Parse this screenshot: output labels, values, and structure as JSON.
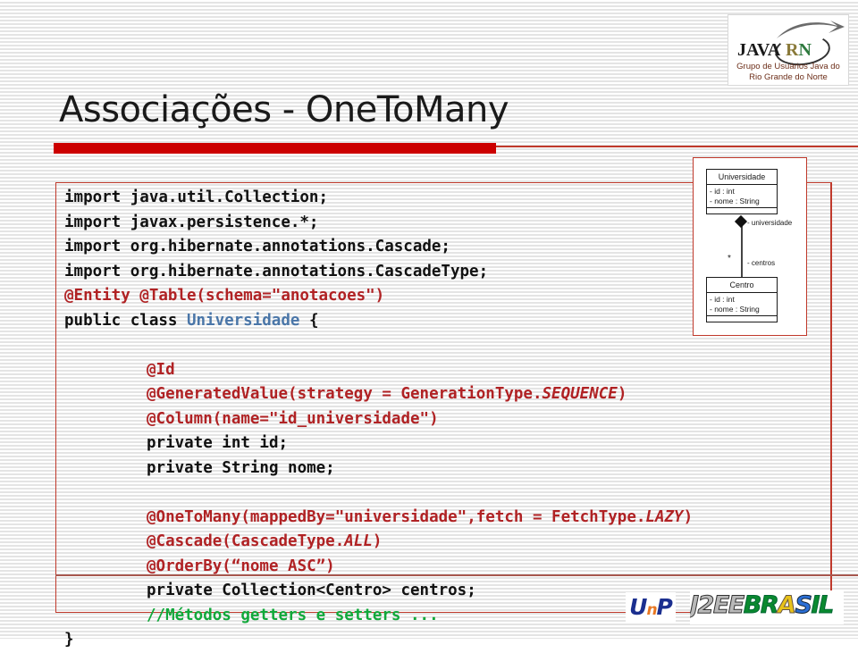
{
  "slide": {
    "title": "Associações - OneToMany"
  },
  "logo_top": {
    "name": "javarn-logo",
    "java_word": "JAVA",
    "rn_r": "R",
    "rn_n": "N",
    "tagline_line1": "Grupo de Usuários Java do",
    "tagline_line2": "Rio Grande do Norte"
  },
  "code": {
    "lines": [
      {
        "indent": false,
        "parts": [
          {
            "text": "import java.util.Collection;",
            "style": "plain"
          }
        ]
      },
      {
        "indent": false,
        "parts": [
          {
            "text": "import javax.persistence.*;",
            "style": "plain"
          }
        ]
      },
      {
        "indent": false,
        "parts": [
          {
            "text": "import org.hibernate.annotations.Cascade;",
            "style": "plain"
          }
        ]
      },
      {
        "indent": false,
        "parts": [
          {
            "text": "import org.hibernate.annotations.CascadeType;",
            "style": "plain"
          }
        ]
      },
      {
        "indent": false,
        "parts": [
          {
            "text": "@Entity @Table(schema=\"anotacoes\")",
            "style": "ann"
          }
        ]
      },
      {
        "indent": false,
        "parts": [
          {
            "text": "public class ",
            "style": "plain"
          },
          {
            "text": "Universidade",
            "style": "cls"
          },
          {
            "text": " {",
            "style": "plain"
          }
        ]
      },
      {
        "indent": false,
        "parts": [
          {
            "text": "",
            "style": "plain"
          }
        ]
      },
      {
        "indent": true,
        "parts": [
          {
            "text": "@Id",
            "style": "ann"
          }
        ]
      },
      {
        "indent": true,
        "parts": [
          {
            "text": "@GeneratedValue(strategy = GenerationType.",
            "style": "ann"
          },
          {
            "text": "SEQUENCE",
            "style": "ann-it"
          },
          {
            "text": ")",
            "style": "ann"
          }
        ]
      },
      {
        "indent": true,
        "parts": [
          {
            "text": "@Column(name=\"id_universidade\")",
            "style": "ann"
          }
        ]
      },
      {
        "indent": true,
        "parts": [
          {
            "text": "private int id;",
            "style": "plain"
          }
        ]
      },
      {
        "indent": true,
        "parts": [
          {
            "text": "private String nome;",
            "style": "plain"
          }
        ]
      },
      {
        "indent": false,
        "parts": [
          {
            "text": "",
            "style": "plain"
          }
        ]
      },
      {
        "indent": true,
        "parts": [
          {
            "text": "@OneToMany(mappedBy=\"universidade\",fetch = FetchType.",
            "style": "ann"
          },
          {
            "text": "LAZY",
            "style": "ann-it"
          },
          {
            "text": ")",
            "style": "ann"
          }
        ]
      },
      {
        "indent": true,
        "parts": [
          {
            "text": "@Cascade(CascadeType.",
            "style": "ann"
          },
          {
            "text": "ALL",
            "style": "ann-it"
          },
          {
            "text": ")",
            "style": "ann"
          }
        ]
      },
      {
        "indent": true,
        "parts": [
          {
            "text": "@OrderBy(“nome ASC”)",
            "style": "ann"
          }
        ]
      },
      {
        "indent": true,
        "parts": [
          {
            "text": "private Collection<Centro> centros;",
            "style": "plain"
          }
        ]
      },
      {
        "indent": true,
        "parts": [
          {
            "text": "//Métodos getters e setters ...",
            "style": "cmt"
          }
        ]
      },
      {
        "indent": false,
        "parts": [
          {
            "text": "}",
            "style": "plain"
          }
        ]
      }
    ]
  },
  "uml": {
    "classes": [
      {
        "name": "Universidade",
        "attributes": [
          "- id : int",
          "- nome : String"
        ]
      },
      {
        "name": "Centro",
        "attributes": [
          "- id : int",
          "- nome : String"
        ]
      }
    ],
    "role_parent": "- universidade",
    "role_child": "- centros",
    "multiplicity": "*"
  },
  "logos_bottom": {
    "unp_u": "U",
    "unp_n": "n",
    "unp_p": "P",
    "j2ee_j2ee": "J2EE",
    "j2ee_br": "BR",
    "j2ee_a": "A",
    "j2ee_s": "S",
    "j2ee_il": "IL"
  },
  "colors": {
    "accent_red": "#cc0000",
    "border_red": "#c0392b",
    "annotation_red": "#b02224",
    "class_blue": "#4a76a8",
    "comment_green": "#11a83a"
  }
}
